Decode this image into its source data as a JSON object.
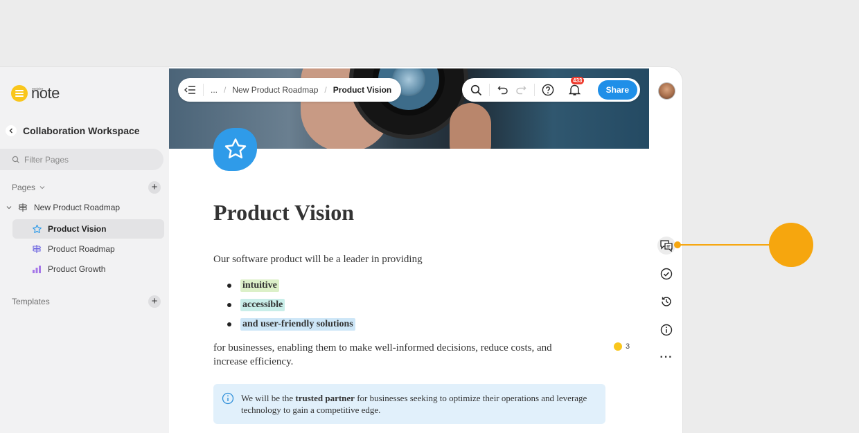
{
  "app": {
    "brand_small": "meister",
    "brand": "note"
  },
  "sidebar": {
    "workspace": "Collaboration Workspace",
    "filter_placeholder": "Filter Pages",
    "pages_label": "Pages",
    "templates_label": "Templates",
    "tree": {
      "root": "New Product Roadmap",
      "items": [
        {
          "label": "Product Vision",
          "icon": "star-icon",
          "active": true
        },
        {
          "label": "Product Roadmap",
          "icon": "roadmap-icon",
          "active": false
        },
        {
          "label": "Product Growth",
          "icon": "bar-chart-icon",
          "active": false
        }
      ]
    }
  },
  "header": {
    "breadcrumb": [
      "...",
      "New Product Roadmap",
      "Product Vision"
    ],
    "notification_count": "433",
    "share_label": "Share"
  },
  "document": {
    "title": "Product Vision",
    "intro": "Our software product will be a leader in providing",
    "bullets": [
      {
        "text": "intuitive",
        "highlight": "#dcf0c8"
      },
      {
        "text": "accessible",
        "highlight": "#c9eee9"
      },
      {
        "text": "and user-friendly solutions",
        "highlight": "#cde6f7"
      }
    ],
    "body": "for businesses, enabling them to make well-informed decisions, reduce costs, and increase efficiency.",
    "comment_count": "3",
    "callout": {
      "before": "We will be the ",
      "bold": "trusted partner",
      "after": " for businesses seeking to optimize their operations and leverage technology to gain a competitive edge."
    }
  },
  "colors": {
    "accent": "#1f8fe8",
    "brand_yellow": "#f9c61c",
    "pointer": "#f6a60e",
    "badge": "#ee3b2e"
  }
}
